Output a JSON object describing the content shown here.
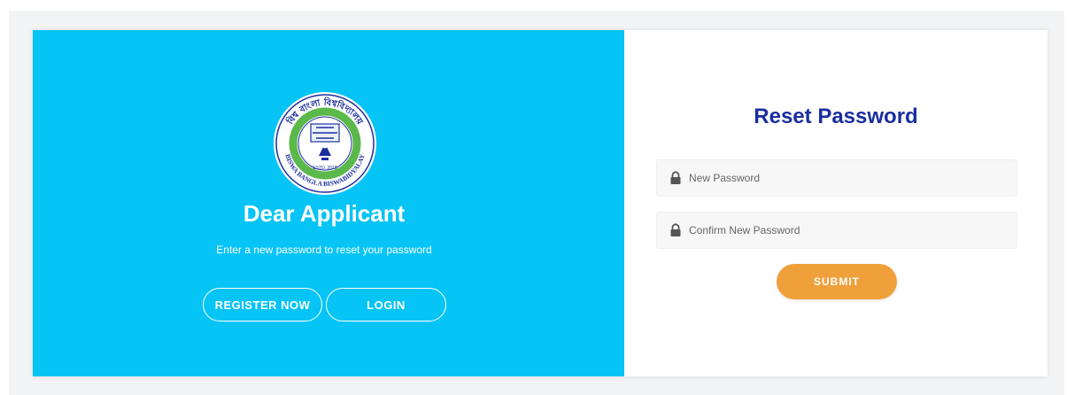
{
  "left": {
    "title": "Dear Applicant",
    "subtitle": "Enter a new password to reset your password",
    "register_label": "REGISTER NOW",
    "login_label": "LOGIN",
    "background": "#06c4f6"
  },
  "logo": {
    "top_text": "বিশ্ব বাংলা বিশ্ববিদ্যালয়",
    "bottom_text": "BISWA BANGLA BISWABIDYALAY",
    "estd": "ESTD. 2018",
    "ring_color": "#1b2e9e",
    "inner_ring_color": "#5bb84a"
  },
  "right": {
    "title": "Reset Password",
    "new_password_placeholder": "New Password",
    "confirm_password_placeholder": "Confirm New Password",
    "submit_label": "SUBMIT",
    "submit_color": "#f0a03b",
    "title_color": "#1b2e9e"
  },
  "icons": [
    "lock-icon",
    "lock-icon"
  ]
}
